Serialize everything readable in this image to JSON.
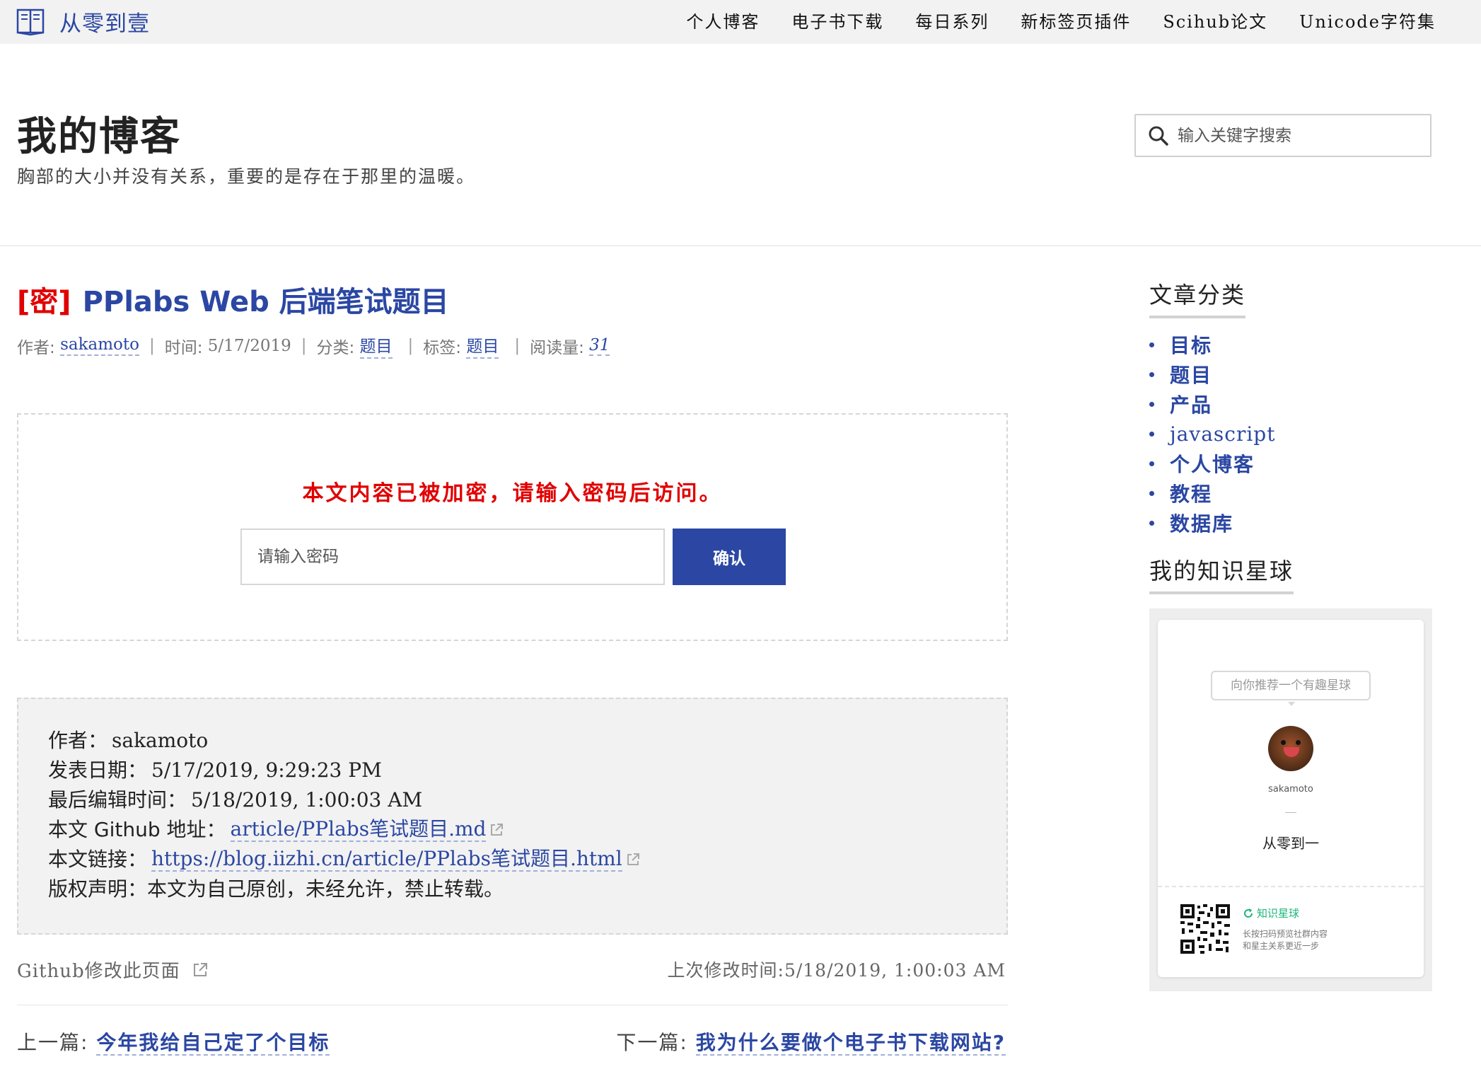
{
  "nav": {
    "logo_text": "从零到壹",
    "items": [
      "个人博客",
      "电子书下载",
      "每日系列",
      "新标签页插件",
      "Scihub论文",
      "Unicode字符集"
    ]
  },
  "header": {
    "title": "我的博客",
    "subtitle": "胸部的大小并没有关系，重要的是存在于那里的温暖。",
    "search_placeholder": "输入关键字搜索"
  },
  "post": {
    "lock_tag": "[密]",
    "title": "PPlabs Web 后端笔试题目",
    "meta": {
      "author_label": "作者:",
      "author": "sakamoto",
      "time_label": "时间:",
      "time": "5/17/2019",
      "category_label": "分类:",
      "category": "题目",
      "tag_label": "标签:",
      "tag": "题目",
      "reads_label": "阅读量:",
      "reads": "31"
    },
    "locked_message": "本文内容已被加密，请输入密码后访问。",
    "password_placeholder": "请输入密码",
    "confirm_label": "确认"
  },
  "info": {
    "author_label": "作者：",
    "author": "sakamoto",
    "published_label": "发表日期：",
    "published": "5/17/2019, 9:29:23 PM",
    "edited_label": "最后编辑时间：",
    "edited": "5/18/2019, 1:00:03 AM",
    "github_label": "本文 Github 地址：",
    "github_link": "article/PPlabs笔试题目.md",
    "url_label": "本文链接：",
    "url": "https://blog.iizhi.cn/article/PPlabs笔试题目.html",
    "copyright_label": "版权声明：",
    "copyright": "本文为自己原创，未经允许，禁止转载。"
  },
  "footer": {
    "edit_link": "Github修改此页面",
    "modified": "上次修改时间:5/18/2019, 1:00:03 AM",
    "prev_label": "上一篇:",
    "prev_title": "今年我给自己定了个目标",
    "next_label": "下一篇:",
    "next_title": "我为什么要做个电子书下载网站?"
  },
  "sidebar": {
    "categories_heading": "文章分类",
    "categories": [
      "目标",
      "题目",
      "产品",
      "javascript",
      "个人博客",
      "教程",
      "数据库"
    ],
    "planet_heading": "我的知识星球",
    "planet": {
      "bubble": "向你推荐一个有趣星球",
      "username": "sakamoto",
      "group_name": "从零到一",
      "brand": "知识星球",
      "desc_line1": "长按扫码预览社群内容",
      "desc_line2": "和星主关系更近一步"
    }
  },
  "colors": {
    "accent": "#2b47a3",
    "locked_red": "#e00000",
    "zsxq_green": "#1fb57a"
  }
}
